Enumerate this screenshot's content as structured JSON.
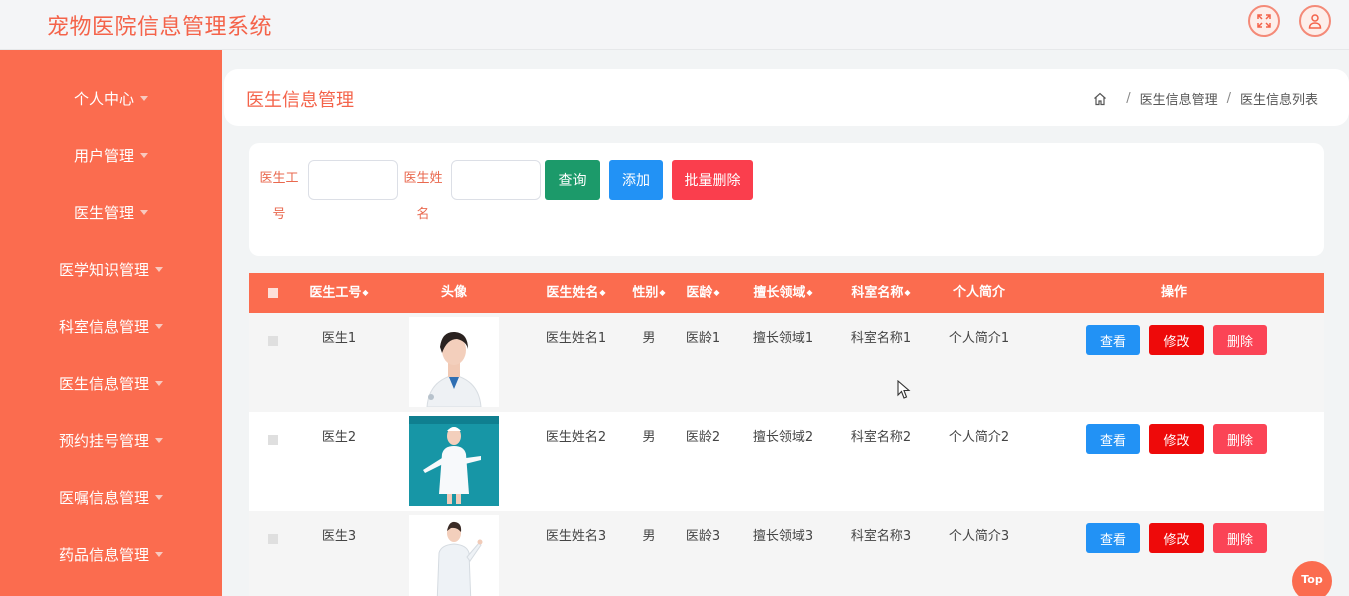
{
  "header": {
    "app_title": "宠物医院信息管理系统",
    "icons": [
      "fullscreen-icon",
      "user-icon"
    ]
  },
  "sidebar": {
    "items": [
      {
        "label": "个人中心"
      },
      {
        "label": "用户管理"
      },
      {
        "label": "医生管理"
      },
      {
        "label": "医学知识管理"
      },
      {
        "label": "科室信息管理"
      },
      {
        "label": "医生信息管理"
      },
      {
        "label": "预约挂号管理"
      },
      {
        "label": "医嘱信息管理"
      },
      {
        "label": "药品信息管理"
      }
    ]
  },
  "titlebar": {
    "title": "医生信息管理",
    "breadcrumb": [
      "医生信息管理",
      "医生信息列表"
    ]
  },
  "search": {
    "doctor_no_label": "医生工号",
    "doctor_name_label": "医生姓名",
    "doctor_no_value": "",
    "doctor_name_value": "",
    "query_label": "查询",
    "add_label": "添加",
    "batch_delete_label": "批量删除"
  },
  "table": {
    "columns": {
      "doctor_no": "医生工号",
      "avatar": "头像",
      "doctor_name": "医生姓名",
      "gender": "性别",
      "age": "医龄",
      "expertise": "擅长领域",
      "department": "科室名称",
      "intro": "个人简介",
      "actions": "操作"
    },
    "action_labels": {
      "view": "查看",
      "edit": "修改",
      "delete": "删除"
    },
    "rows": [
      {
        "doctor_no": "医生1",
        "doctor_name": "医生姓名1",
        "gender": "男",
        "age": "医龄1",
        "expertise": "擅长领域1",
        "department": "科室名称1",
        "intro": "个人简介1"
      },
      {
        "doctor_no": "医生2",
        "doctor_name": "医生姓名2",
        "gender": "男",
        "age": "医龄2",
        "expertise": "擅长领域2",
        "department": "科室名称2",
        "intro": "个人简介2"
      },
      {
        "doctor_no": "医生3",
        "doctor_name": "医生姓名3",
        "gender": "男",
        "age": "医龄3",
        "expertise": "擅长领域3",
        "department": "科室名称3",
        "intro": "个人简介3"
      }
    ]
  },
  "back_to_top_label": "Top",
  "colors": {
    "accent": "#fb6c4f",
    "query_button": "#1c9a6a",
    "add_button": "#2292f5",
    "batch_delete_button": "#fa3e4d",
    "view_button": "#2292f5",
    "edit_button": "#ee0a0a",
    "delete_button": "#fb4456"
  }
}
